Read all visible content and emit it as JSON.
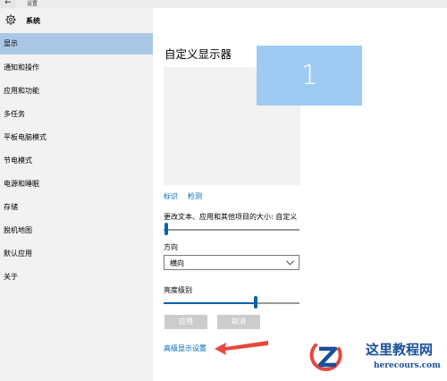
{
  "window": {
    "back_glyph": "←",
    "title": "设置"
  },
  "sidebar": {
    "header": "系统",
    "items": [
      {
        "label": "显示"
      },
      {
        "label": "通知和操作"
      },
      {
        "label": "应用和功能"
      },
      {
        "label": "多任务"
      },
      {
        "label": "平板电脑模式"
      },
      {
        "label": "节电模式"
      },
      {
        "label": "电源和睡眠"
      },
      {
        "label": "存储"
      },
      {
        "label": "脱机地图"
      },
      {
        "label": "默认应用"
      },
      {
        "label": "关于"
      }
    ]
  },
  "main": {
    "title": "自定义显示器",
    "monitor_number": "1",
    "identify_link": "标识",
    "detect_link": "检测",
    "scale_label": "更改文本、应用和其他项目的大小: 自定义",
    "orientation": {
      "label": "方向",
      "value": "横向"
    },
    "brightness": {
      "label": "亮度级别",
      "level": 0.68
    },
    "apply_button": "应用",
    "cancel_button": "取消",
    "advanced_link": "高级显示设置"
  },
  "watermark": {
    "title": "这里教程网",
    "url": "herecours.com"
  },
  "colors": {
    "accent": "#0063b1",
    "active_item": "#aac8e6",
    "link": "#0067b8",
    "annotation_arrow": "#e8473c"
  }
}
